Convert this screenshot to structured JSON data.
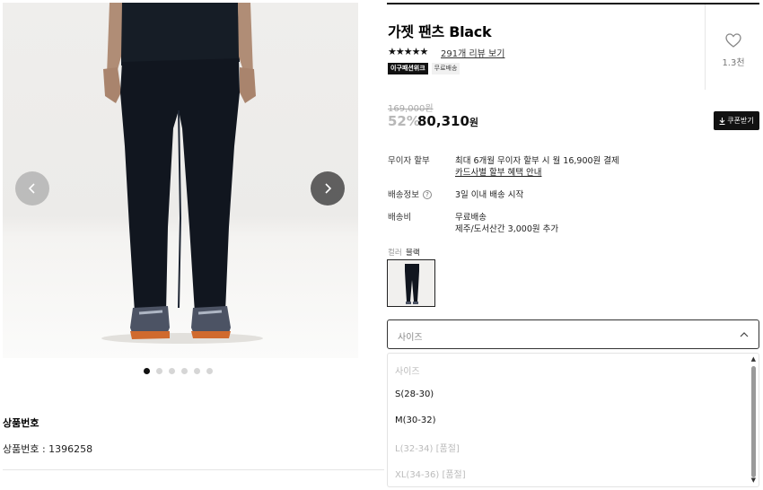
{
  "product": {
    "title": "가젯 팬츠 Black",
    "stars": "★★★★★",
    "review_link": "291개 리뷰 보기",
    "badges": [
      "이구패션위크",
      "무료배송"
    ],
    "like_count": "1.3천",
    "original_price": "169,000원",
    "discount": "52%",
    "price": "80,310",
    "price_unit": "원",
    "coupon_label": "쿠폰받기"
  },
  "info": {
    "installment_label": "무이자 할부",
    "installment_value": "최대 6개월 무이자 할부 시 월 16,900원 결제",
    "installment_link": "카드사별 할부 혜택 안내",
    "shipping_label": "배송정보",
    "shipping_help": "?",
    "shipping_value": "3일 이내 배송 시작",
    "fee_label": "배송비",
    "fee_value": "무료배송",
    "fee_extra": "제주/도서산간 3,000원 추가"
  },
  "color": {
    "label": "컬러",
    "value": "블랙"
  },
  "size_select": {
    "label": "사이즈",
    "options": [
      {
        "label": "사이즈",
        "state": "placeholder"
      },
      {
        "label": "S(28-30)",
        "state": "available"
      },
      {
        "label": "M(30-32)",
        "state": "available"
      },
      {
        "label": "L(32-34) [품절]",
        "state": "soldout"
      },
      {
        "label": "XL(34-36) [품절]",
        "state": "soldout"
      }
    ]
  },
  "gallery": {
    "image_count": 6,
    "active_index": 0
  },
  "product_number": {
    "heading": "상품번호",
    "text": "상품번호 : 1396258"
  },
  "colors": {
    "accent": "#111111",
    "muted": "#b8b8b8",
    "pants": "#11161f"
  },
  "icons": {
    "prev": "chevron-left-icon",
    "next": "chevron-right-icon",
    "like": "heart-icon",
    "coupon": "download-icon",
    "select": "chevron-up-icon"
  }
}
